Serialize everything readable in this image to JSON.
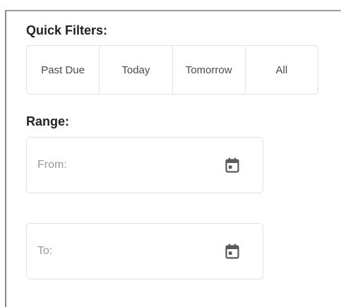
{
  "quick_filters": {
    "title": "Quick Filters:",
    "options": [
      {
        "label": "Past Due"
      },
      {
        "label": "Today"
      },
      {
        "label": "Tomorrow"
      },
      {
        "label": "All"
      }
    ]
  },
  "range": {
    "title": "Range:",
    "from": {
      "value": "",
      "placeholder": "From:",
      "icon": "calendar-icon"
    },
    "to": {
      "value": "",
      "placeholder": "To:",
      "icon": "calendar-icon"
    }
  },
  "colors": {
    "text": "#222222",
    "muted": "#9a9a9a",
    "border": "#e4e4e4",
    "icon": "#5a5a5a"
  }
}
